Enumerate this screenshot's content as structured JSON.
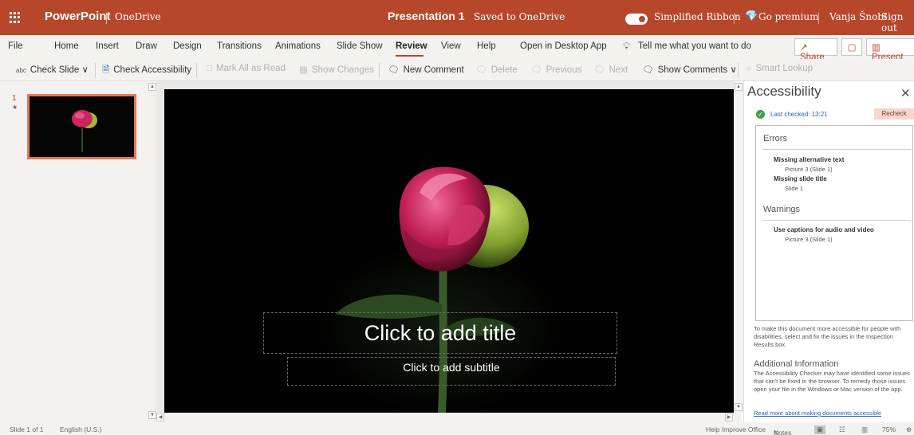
{
  "titlebar": {
    "app": "PowerPoint",
    "location": "OneDrive",
    "doc_title": "Presentation 1",
    "separator": "-",
    "save_status": "Saved to OneDrive",
    "simplified_ribbon": "Simplified Ribbon",
    "premium": "Go premium",
    "user": "Vanja Šnobl",
    "sign_out": "Sign out",
    "toggle_on": true
  },
  "menu": {
    "tabs": [
      "File",
      "Home",
      "Insert",
      "Draw",
      "Design",
      "Transitions",
      "Animations",
      "Slide Show",
      "Review",
      "View",
      "Help",
      "Open in Desktop App"
    ],
    "active_tab": "Review",
    "tell_me": "Tell me what you want to do",
    "share": "Share",
    "present": "Present"
  },
  "ribbon": {
    "check_slide": "Check Slide",
    "check_accessibility": "Check Accessibility",
    "mark_all_read": "Mark All as Read",
    "show_changes": "Show Changes",
    "new_comment": "New Comment",
    "delete": "Delete",
    "previous": "Previous",
    "next": "Next",
    "show_comments": "Show Comments",
    "smart_lookup": "Smart Lookup"
  },
  "thumbnails": {
    "slide_number": "1",
    "star": "★"
  },
  "slide": {
    "title_placeholder": "Click to add title",
    "subtitle_placeholder": "Click to add subtitle"
  },
  "accessibility": {
    "title": "Accessibility",
    "last_checked": "Last checked: 13:21",
    "recheck": "Recheck",
    "errors_heading": "Errors",
    "errors": [
      {
        "issue": "Missing alternative text",
        "location": "Picture 3 (Slide 1)"
      },
      {
        "issue": "Missing slide title",
        "location": "Slide 1"
      }
    ],
    "warnings_heading": "Warnings",
    "warnings": [
      {
        "issue": "Use captions for audio and video",
        "location": "Picture 3 (Slide 1)"
      }
    ],
    "description": "To make this document more accessible for people with disabilities, select and fix the issues in the Inspection Results box.",
    "additional_heading": "Additional Information",
    "additional_text": "The Accessibility Checker may have identified some issues that can't be fixed in the browser. To remedy those issues open your file in the Windows or Mac version of the app.",
    "read_more": "Read more about making documents accessible"
  },
  "status": {
    "slide_of": "Slide 1 of 1",
    "language": "English (U.S.)",
    "help_improve": "Help Improve Office",
    "notes": "Notes",
    "zoom": "75%"
  },
  "colors": {
    "brand": "#b7472a",
    "thumb_border": "#e67659",
    "recheck_bg": "#f8d6cc",
    "link": "#2266bb"
  }
}
